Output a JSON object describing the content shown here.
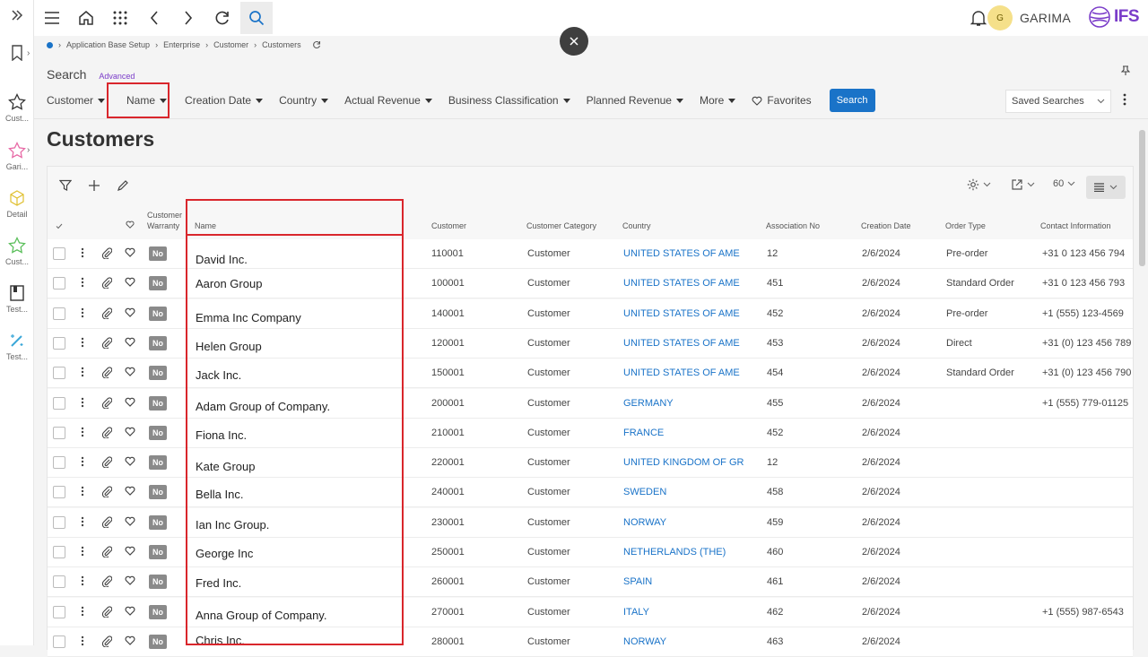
{
  "rail": {
    "items": [
      {
        "label": "Cust...",
        "icon": "star-icon"
      },
      {
        "label": "Gari...",
        "icon": "star-pink-icon"
      },
      {
        "label": "Detail",
        "icon": "cube-icon"
      },
      {
        "label": "Cust...",
        "icon": "star-green-icon"
      },
      {
        "label": "Test...",
        "icon": "book-icon"
      },
      {
        "label": "Test...",
        "icon": "wand-icon"
      }
    ]
  },
  "topbar": {
    "user_initial": "G",
    "user_name": "GARIMA",
    "logo_text": "IFS"
  },
  "breadcrumb": [
    "Application Base Setup",
    "Enterprise",
    "Customer",
    "Customers"
  ],
  "search": {
    "title": "Search",
    "advanced": "Advanced"
  },
  "filters": [
    "Customer",
    "Name",
    "Creation Date",
    "Country",
    "Actual Revenue",
    "Business Classification",
    "Planned Revenue",
    "More"
  ],
  "favorites_label": "Favorites",
  "search_button": "Search",
  "saved_searches": "Saved Searches",
  "page_title": "Customers",
  "page_size": "60",
  "columns": {
    "warranty": "Customer Warranty",
    "name": "Name",
    "customer": "Customer",
    "category": "Customer Category",
    "country": "Country",
    "association": "Association No",
    "creation_date": "Creation Date",
    "order_type": "Order Type",
    "contact": "Contact Information"
  },
  "rows": [
    {
      "warranty": "No",
      "name": "David Inc.",
      "customer": "110001",
      "category": "Customer",
      "country": "UNITED STATES OF AME",
      "association": "12",
      "date": "2/6/2024",
      "order_type": "Pre-order",
      "contact": "+31 0 123 456 794"
    },
    {
      "warranty": "No",
      "name": "Aaron Group",
      "customer": "100001",
      "category": "Customer",
      "country": "UNITED STATES OF AME",
      "association": "451",
      "date": "2/6/2024",
      "order_type": "Standard Order",
      "contact": "+31 0 123 456 793"
    },
    {
      "warranty": "No",
      "name": "Emma Inc Company",
      "customer": "140001",
      "category": "Customer",
      "country": "UNITED STATES OF AME",
      "association": "452",
      "date": "2/6/2024",
      "order_type": "Pre-order",
      "contact": "+1 (555) 123-4569"
    },
    {
      "warranty": "No",
      "name": "Helen Group",
      "customer": "120001",
      "category": "Customer",
      "country": "UNITED STATES OF AME",
      "association": "453",
      "date": "2/6/2024",
      "order_type": "Direct",
      "contact": "+31 (0) 123 456 789"
    },
    {
      "warranty": "No",
      "name": "Jack Inc.",
      "customer": "150001",
      "category": "Customer",
      "country": "UNITED STATES OF AME",
      "association": "454",
      "date": "2/6/2024",
      "order_type": "Standard Order",
      "contact": "+31 (0) 123 456 790"
    },
    {
      "warranty": "No",
      "name": "Adam Group of Company.",
      "customer": "200001",
      "category": "Customer",
      "country": "GERMANY",
      "association": "455",
      "date": "2/6/2024",
      "order_type": "",
      "contact": "+1 (555) 779-01125"
    },
    {
      "warranty": "No",
      "name": "Fiona Inc.",
      "customer": "210001",
      "category": "Customer",
      "country": "FRANCE",
      "association": "452",
      "date": "2/6/2024",
      "order_type": "",
      "contact": ""
    },
    {
      "warranty": "No",
      "name": "Kate Group",
      "customer": "220001",
      "category": "Customer",
      "country": "UNITED KINGDOM OF GR",
      "association": "12",
      "date": "2/6/2024",
      "order_type": "",
      "contact": ""
    },
    {
      "warranty": "No",
      "name": "Bella Inc.",
      "customer": "240001",
      "category": "Customer",
      "country": "SWEDEN",
      "association": "458",
      "date": "2/6/2024",
      "order_type": "",
      "contact": ""
    },
    {
      "warranty": "No",
      "name": "Ian Inc Group.",
      "customer": "230001",
      "category": "Customer",
      "country": "NORWAY",
      "association": "459",
      "date": "2/6/2024",
      "order_type": "",
      "contact": ""
    },
    {
      "warranty": "No",
      "name": "George Inc",
      "customer": "250001",
      "category": "Customer",
      "country": "NETHERLANDS (THE)",
      "association": "460",
      "date": "2/6/2024",
      "order_type": "",
      "contact": ""
    },
    {
      "warranty": "No",
      "name": "Fred Inc.",
      "customer": "260001",
      "category": "Customer",
      "country": "SPAIN",
      "association": "461",
      "date": "2/6/2024",
      "order_type": "",
      "contact": ""
    },
    {
      "warranty": "No",
      "name": "Anna Group of Company.",
      "customer": "270001",
      "category": "Customer",
      "country": "ITALY",
      "association": "462",
      "date": "2/6/2024",
      "order_type": "",
      "contact": "+1 (555) 987-6543"
    },
    {
      "warranty": "No",
      "name": "Chris Inc.",
      "customer": "280001",
      "category": "Customer",
      "country": "NORWAY",
      "association": "463",
      "date": "2/6/2024",
      "order_type": "",
      "contact": ""
    }
  ]
}
